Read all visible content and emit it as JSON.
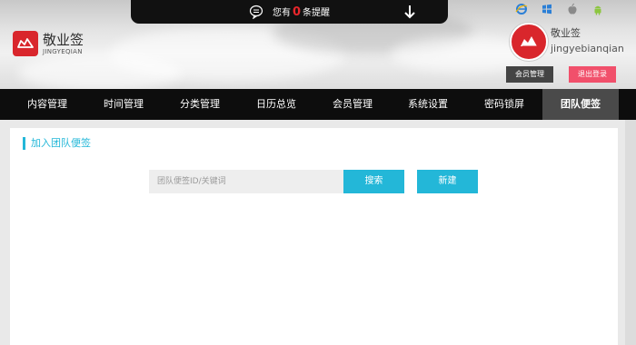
{
  "header": {
    "logo_name": "敬业签",
    "logo_sub": "JINGYEQIAN",
    "notification": {
      "prefix": "您有",
      "count": "0",
      "suffix": "条提醒"
    },
    "platforms": [
      "ie-icon",
      "windows-icon",
      "apple-icon",
      "android-icon"
    ],
    "user": {
      "name": "敬业签",
      "id": "jingyebianqian",
      "member_button": "会员管理",
      "logout_button": "退出登录"
    }
  },
  "nav": {
    "items": [
      {
        "label": "内容管理"
      },
      {
        "label": "时间管理"
      },
      {
        "label": "分类管理"
      },
      {
        "label": "日历总览"
      },
      {
        "label": "会员管理"
      },
      {
        "label": "系统设置"
      },
      {
        "label": "密码锁屏"
      },
      {
        "label": "团队便签",
        "active": true
      }
    ]
  },
  "main": {
    "section_title": "加入团队便签",
    "search_placeholder": "团队便签ID/关键词",
    "search_value": "",
    "search_button": "搜索",
    "new_button": "新建"
  },
  "colors": {
    "accent": "#23b7d8",
    "brand_red": "#d9262c",
    "logout_pink": "#f1506b",
    "nav_bg": "#0d0d0d",
    "nav_active": "#4a4a4a"
  }
}
